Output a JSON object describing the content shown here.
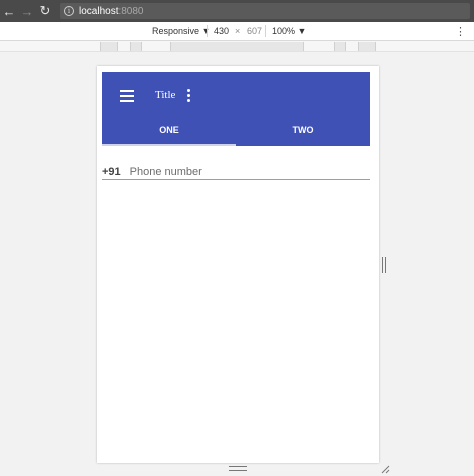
{
  "browser": {
    "url_host": "localhost",
    "url_port": ":8080",
    "icons": [
      "back-arrow-icon",
      "forward-arrow-icon",
      "reload-icon",
      "info-icon"
    ]
  },
  "device_toolbar": {
    "device": "Responsive",
    "width": "430",
    "times": "×",
    "height": "607",
    "zoom": "100%"
  },
  "app": {
    "title": "Title",
    "tabs": [
      {
        "label": "ONE",
        "active": true
      },
      {
        "label": "TWO",
        "active": false
      }
    ],
    "phone": {
      "prefix": "+91",
      "placeholder": "Phone number"
    },
    "colors": {
      "primary": "#3f51b5",
      "indicator": "#cfd3ea"
    }
  }
}
